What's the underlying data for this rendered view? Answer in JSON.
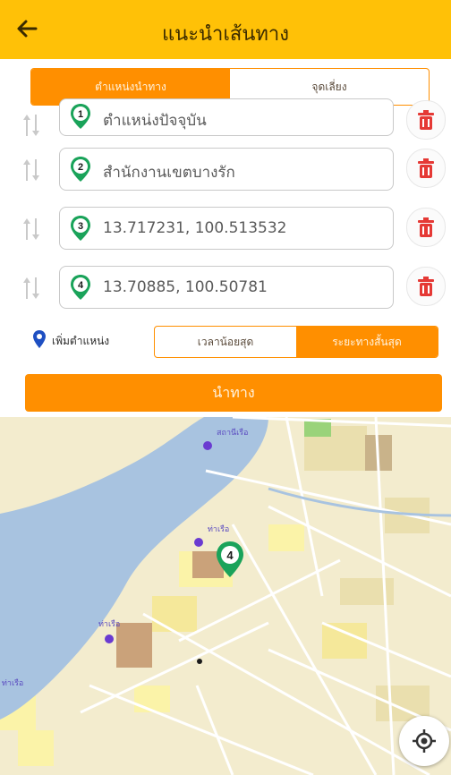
{
  "header": {
    "title": "แนะนำเส้นทาง",
    "back_icon": "arrow-left-icon"
  },
  "mode_tabs": {
    "active": "ตำแหน่งนำทาง",
    "inactive": "จุดเลี่ยง"
  },
  "waypoints": [
    {
      "number": "1",
      "text": "ตำแหน่งปัจจุบัน"
    },
    {
      "number": "2",
      "text": "สำนักงานเขตบางรัก"
    },
    {
      "number": "3",
      "text": "13.717231, 100.513532"
    },
    {
      "number": "4",
      "text": "13.70885, 100.50781"
    }
  ],
  "add_location_label": "เพิ่มตำแหน่ง",
  "route_options": {
    "inactive": "เวลาน้อยสุด",
    "active": "ระยะทางสั้นสุด"
  },
  "navigate_label": "นำทาง",
  "map": {
    "marker_number": "4",
    "labels": [
      "สถานีเรือ",
      "ท่าเรือ",
      "ท่าเรือ",
      "ท่าเรือ"
    ],
    "locate_icon": "crosshair-icon"
  },
  "colors": {
    "header": "#ffc107",
    "accent": "#ff8f00",
    "pin": "#1aa35a",
    "trash": "#e53935"
  }
}
